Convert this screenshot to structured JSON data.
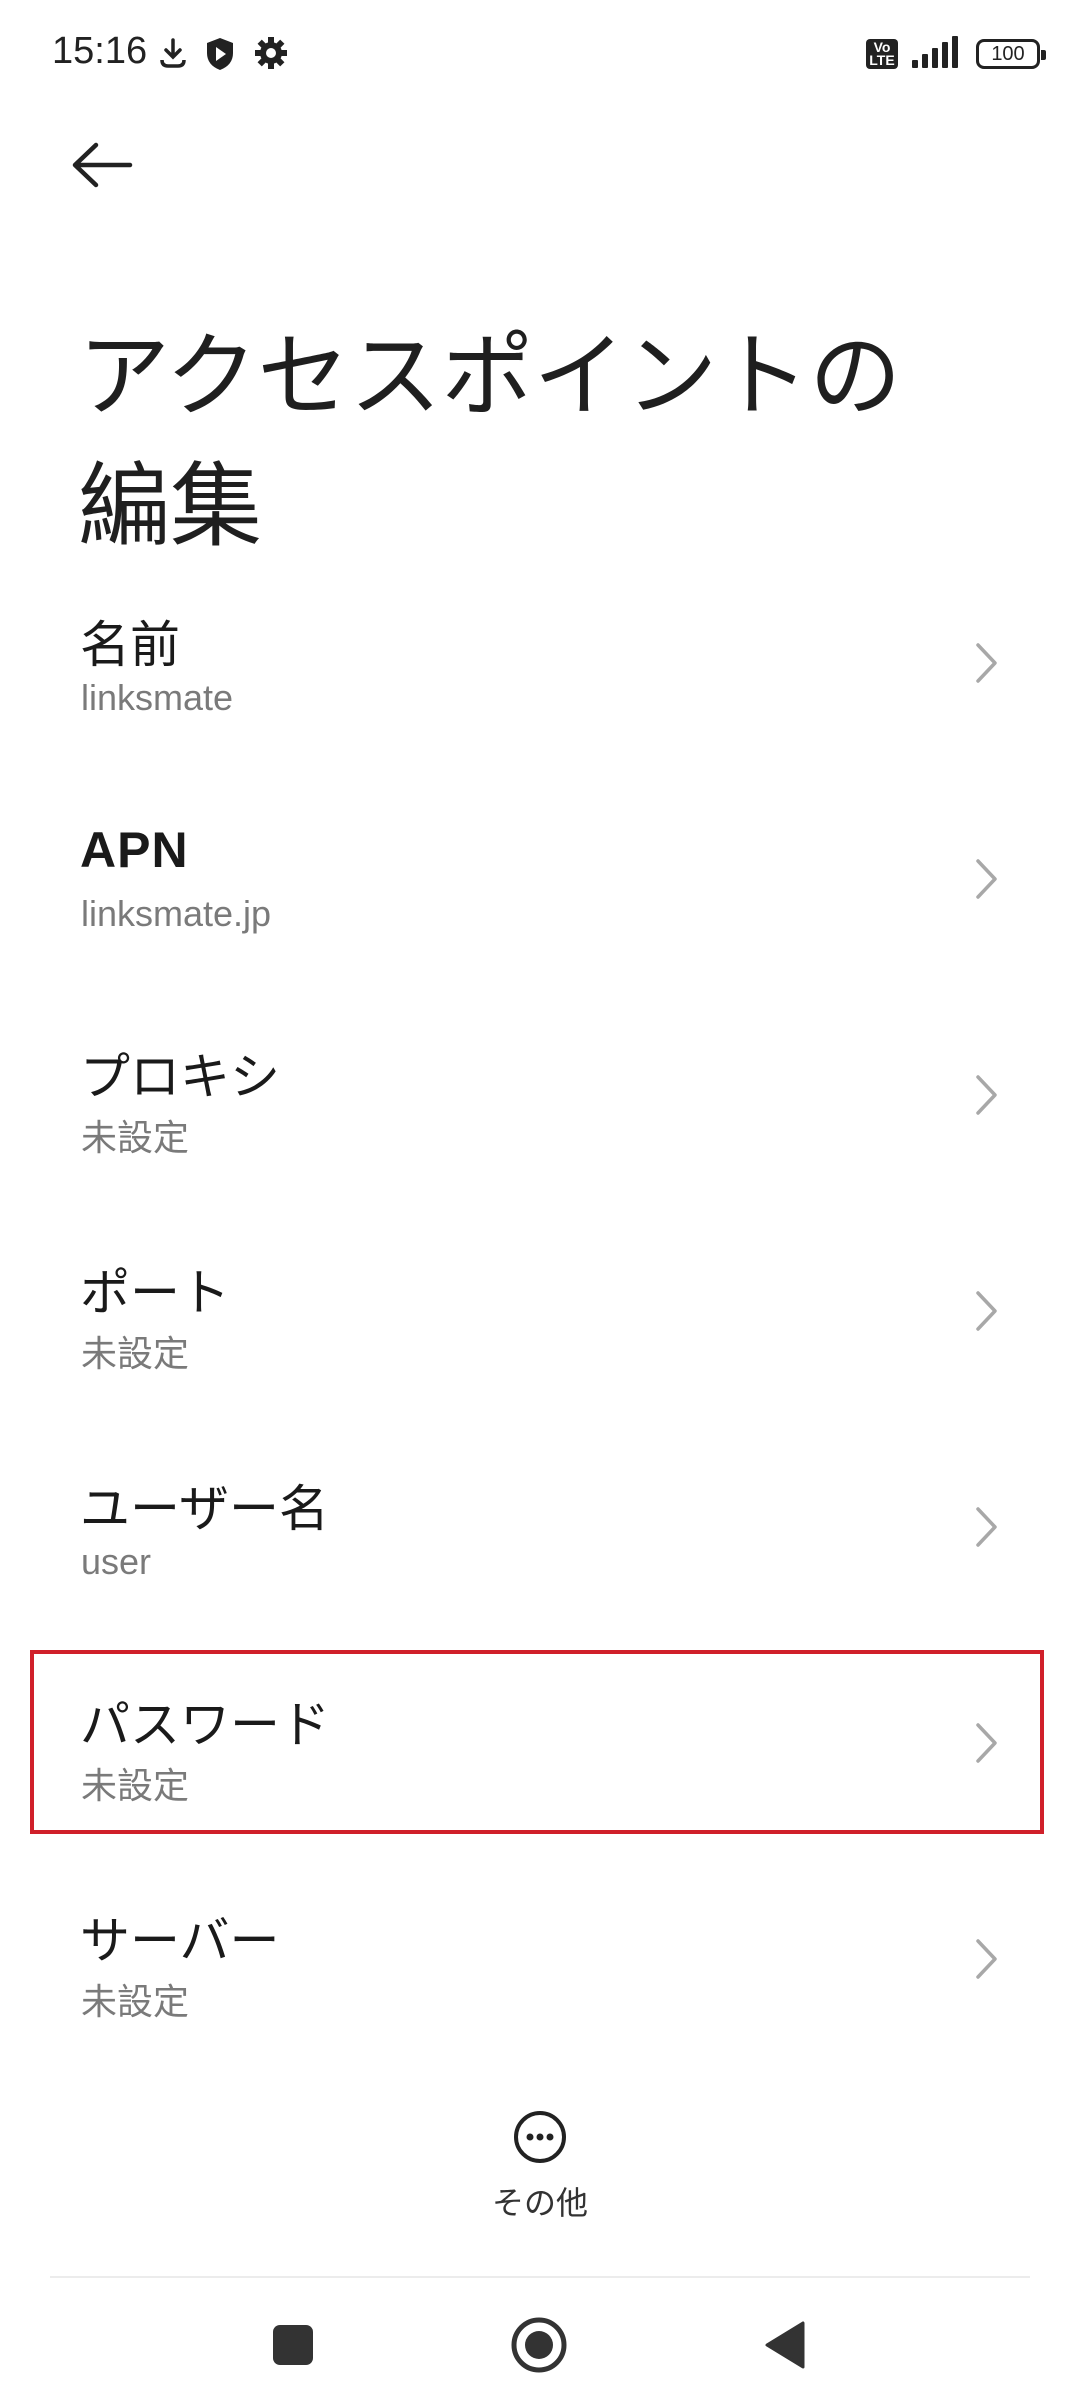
{
  "status_bar": {
    "time": "15:16",
    "left_icons": [
      "download-icon",
      "shield-play-icon",
      "gear-icon"
    ],
    "volte_top": "Vo",
    "volte_bottom": "LTE",
    "battery": "100"
  },
  "header": {
    "back_icon": "arrow-left-icon",
    "title": "アクセスポイントの編集"
  },
  "items": [
    {
      "label": "名前",
      "value": "linksmate"
    },
    {
      "label": "APN",
      "value": "linksmate.jp"
    },
    {
      "label": "プロキシ",
      "value": "未設定"
    },
    {
      "label": "ポート",
      "value": "未設定"
    },
    {
      "label": "ユーザー名",
      "value": "user"
    },
    {
      "label": "パスワード",
      "value": "未設定"
    },
    {
      "label": "サーバー",
      "value": "未設定"
    }
  ],
  "more": {
    "icon": "more-horizontal-icon",
    "label": "その他"
  },
  "highlight_color": "#d0202a",
  "nav": [
    "square-icon",
    "home-circle-icon",
    "back-triangle-icon"
  ]
}
